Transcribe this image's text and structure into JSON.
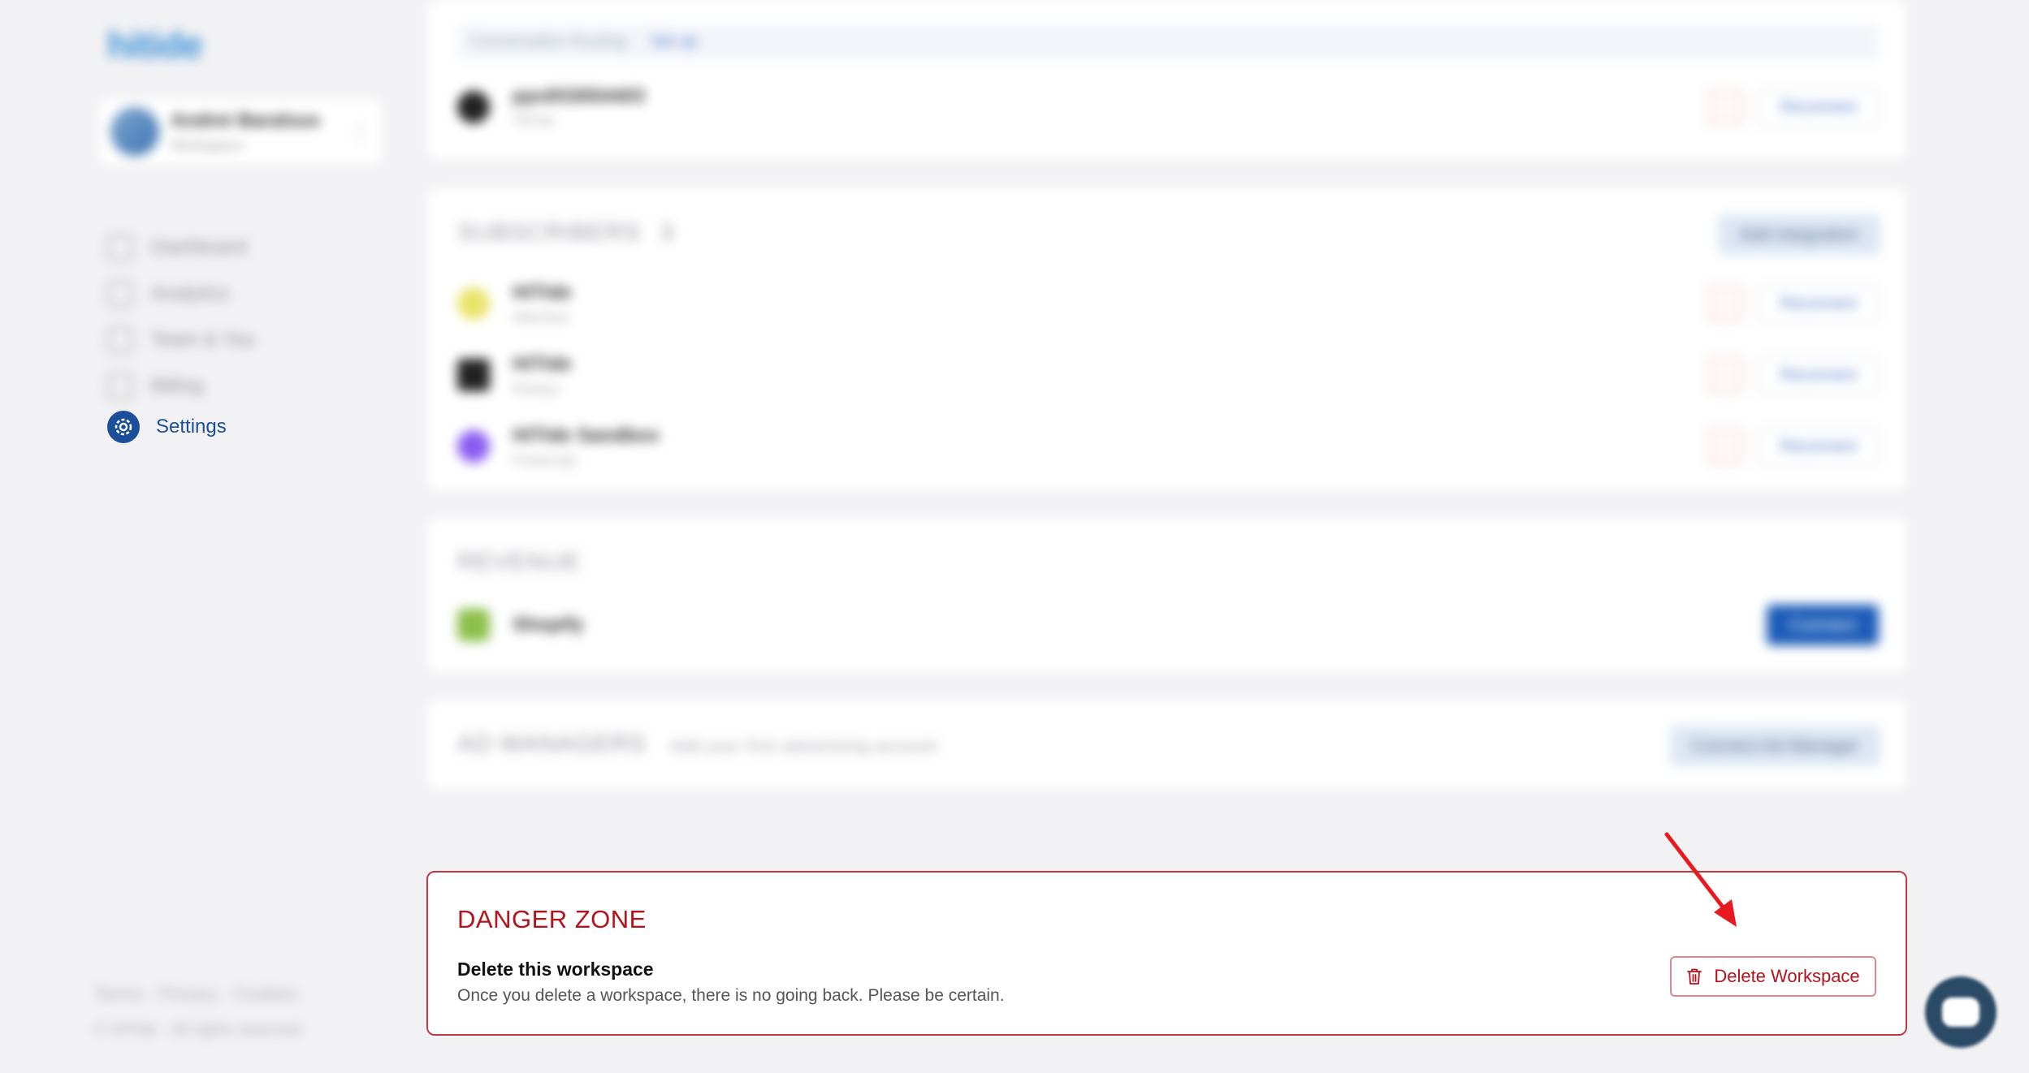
{
  "sidebar": {
    "logo": "hitide",
    "user": {
      "name": "Andrei Baralsus",
      "subtitle": "Workspace"
    },
    "nav": [
      {
        "label": "Dashboard"
      },
      {
        "label": "Analytics"
      },
      {
        "label": "Team & You"
      },
      {
        "label": "Billing"
      },
      {
        "label": "Settings",
        "active": true
      }
    ],
    "footer_links": "Terms · Privacy · Cookies",
    "copyright": "© HiTide · All rights reserved"
  },
  "top_card": {
    "routing_label": "Conversation Routing",
    "routing_link": "Set up",
    "account": {
      "title": "pps933054403",
      "subtitle": "TikTok",
      "reconnect": "Reconnect"
    }
  },
  "subscribers": {
    "title": "SUBSCRIBERS",
    "count": "3",
    "add_button": "Add integration",
    "items": [
      {
        "title": "HiTide",
        "subtitle": "Attentive",
        "reconnect": "Reconnect"
      },
      {
        "title": "HiTide",
        "subtitle": "Klaviyo",
        "reconnect": "Reconnect"
      },
      {
        "title": "HiTide Sandbox",
        "subtitle": "Postscript",
        "reconnect": "Reconnect"
      }
    ]
  },
  "revenue": {
    "title": "REVENUE",
    "shopify": "Shopify",
    "connect": "Connect"
  },
  "ad_managers": {
    "title": "AD MANAGERS",
    "hint": "Add your first advertising account",
    "connect": "Connect Ad Manager"
  },
  "danger_zone": {
    "title": "DANGER ZONE",
    "heading": "Delete this workspace",
    "description": "Once you delete a workspace, there is no going back. Please be certain.",
    "delete_button": "Delete Workspace"
  },
  "colors": {
    "danger": "#b5121b",
    "primary": "#1b5bb7",
    "arrow": "#e8191f"
  }
}
